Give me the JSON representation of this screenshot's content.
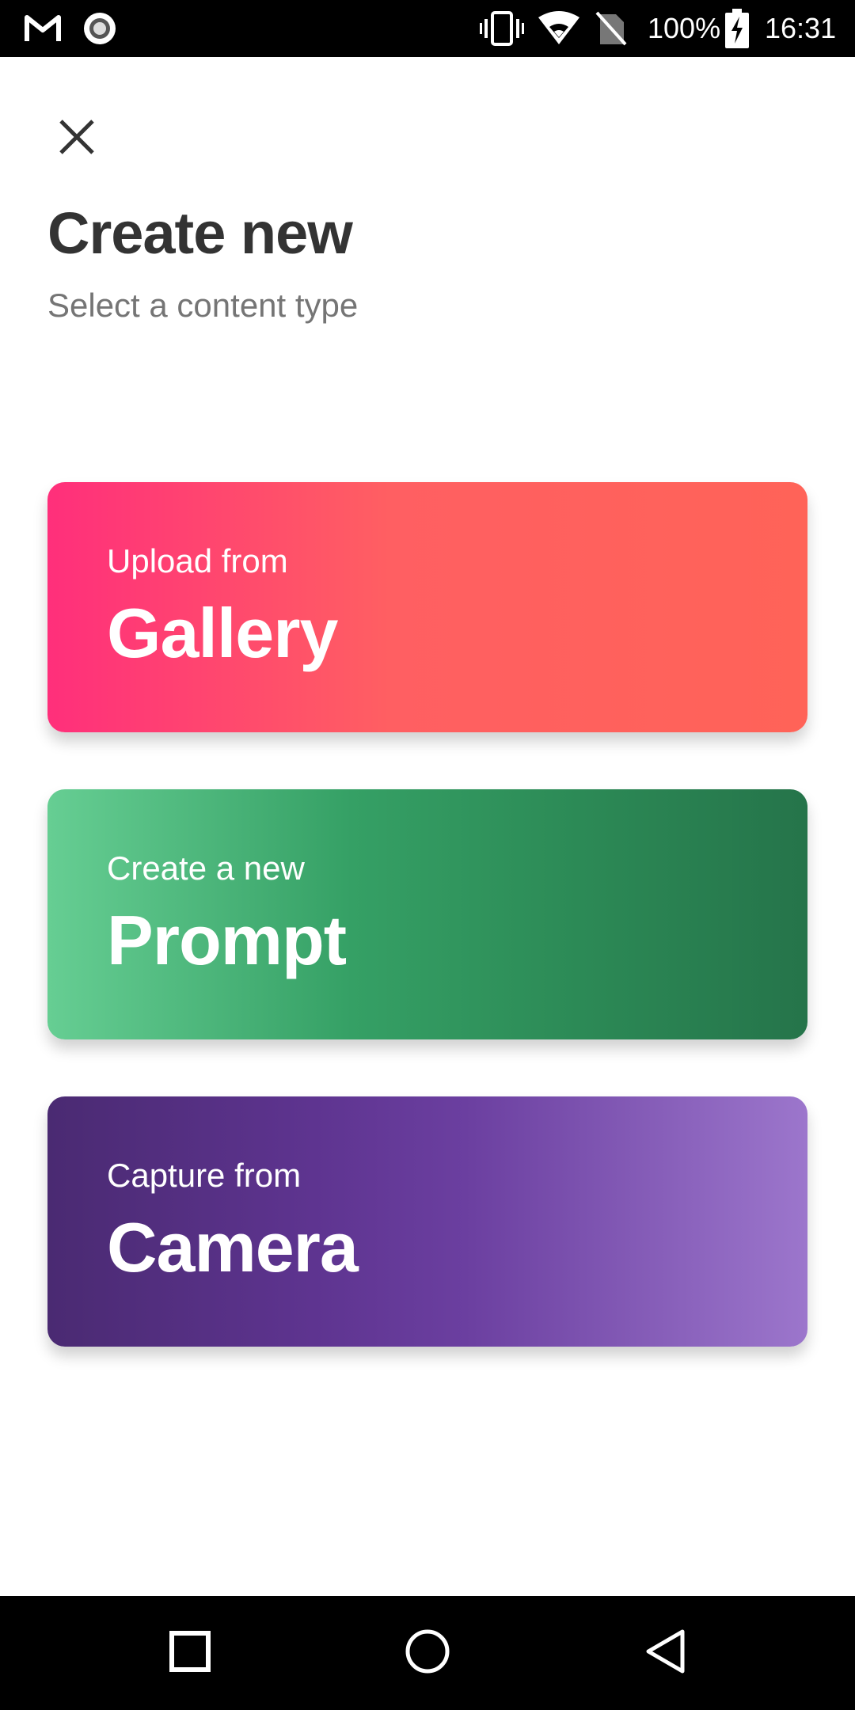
{
  "status_bar": {
    "battery_percent": "100%",
    "time": "16:31",
    "icons": [
      "gmail-icon",
      "recording-icon",
      "vibrate-icon",
      "wifi-icon",
      "no-sim-icon",
      "battery-charging-icon"
    ]
  },
  "header": {
    "close_icon": "close-icon",
    "title": "Create new",
    "subtitle": "Select a content type"
  },
  "options": [
    {
      "small": "Upload from",
      "big": "Gallery",
      "colors": [
        "#ff2f7b",
        "#ff6358"
      ]
    },
    {
      "small": "Create a new",
      "big": "Prompt",
      "colors": [
        "#66ce93",
        "#25744a"
      ]
    },
    {
      "small": "Capture from",
      "big": "Camera",
      "colors": [
        "#4a2a72",
        "#9c76cc"
      ]
    }
  ],
  "nav_bar": {
    "icons": [
      "recents-icon",
      "home-icon",
      "back-icon"
    ]
  }
}
